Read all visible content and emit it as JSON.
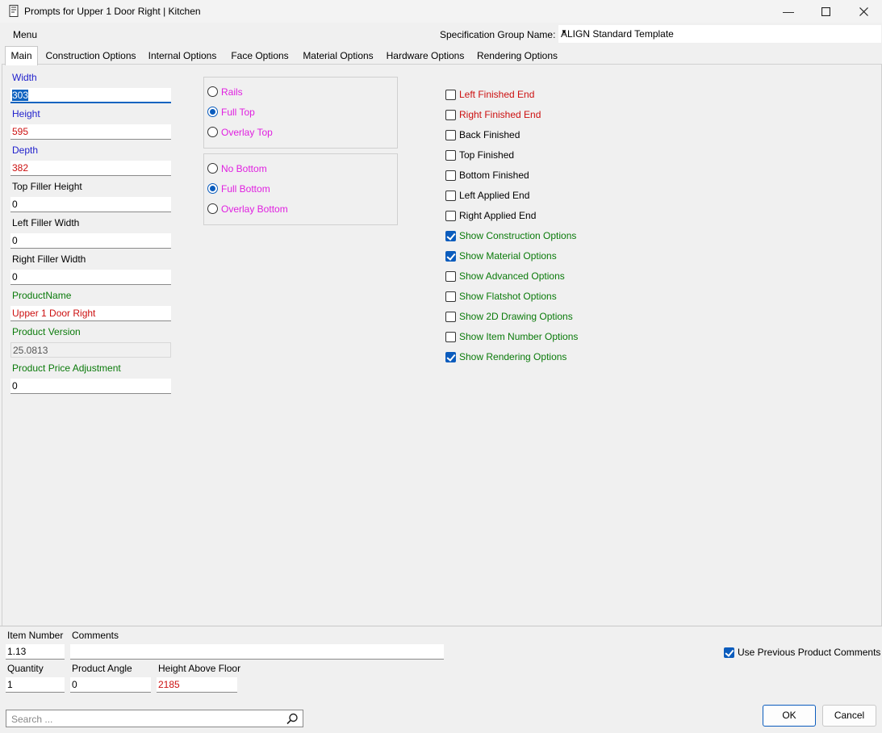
{
  "window": {
    "title": "Prompts for Upper 1 Door Right | Kitchen"
  },
  "menu": {
    "label": "Menu"
  },
  "spec": {
    "label": "Specification Group Name:",
    "value": "ALIGN Standard Template"
  },
  "tabs": [
    "Main",
    "Construction Options",
    "Internal Options",
    "Face Options",
    "Material Options",
    "Hardware Options",
    "Rendering Options"
  ],
  "fields": [
    {
      "label": "Width",
      "value": "303"
    },
    {
      "label": "Height",
      "value": "595"
    },
    {
      "label": "Depth",
      "value": "382"
    },
    {
      "label": "Top Filler Height",
      "value": "0"
    },
    {
      "label": "Left Filler Width",
      "value": "0"
    },
    {
      "label": "Right Filler Width",
      "value": "0"
    },
    {
      "label": "ProductName",
      "value": "Upper 1 Door Right"
    },
    {
      "label": "Product Version",
      "value": "25.0813"
    },
    {
      "label": "Product Price Adjustment",
      "value": "0"
    }
  ],
  "top_group": {
    "options": [
      "Rails",
      "Full Top",
      "Overlay Top"
    ],
    "selected": "Full Top"
  },
  "bottom_group": {
    "options": [
      "No Bottom",
      "Full Bottom",
      "Overlay Bottom"
    ],
    "selected": "Full Bottom"
  },
  "checkboxes": [
    {
      "label": "Left Finished End",
      "checked": false
    },
    {
      "label": "Right Finished End",
      "checked": false
    },
    {
      "label": "Back Finished",
      "checked": false
    },
    {
      "label": "Top Finished",
      "checked": false
    },
    {
      "label": "Bottom Finished",
      "checked": false
    },
    {
      "label": "Left Applied End",
      "checked": false
    },
    {
      "label": "Right Applied End",
      "checked": false
    },
    {
      "label": "Show Construction Options",
      "checked": true
    },
    {
      "label": "Show Material Options",
      "checked": true
    },
    {
      "label": "Show Advanced Options",
      "checked": false
    },
    {
      "label": "Show Flatshot Options",
      "checked": false
    },
    {
      "label": "Show 2D Drawing Options",
      "checked": false
    },
    {
      "label": "Show Item Number Options",
      "checked": false
    },
    {
      "label": "Show Rendering Options",
      "checked": true
    }
  ],
  "bottom": {
    "item_number": {
      "label": "Item Number",
      "value": "1.13"
    },
    "comments": {
      "label": "Comments",
      "value": ""
    },
    "use_previous": {
      "label": "Use Previous Product Comments",
      "checked": true
    },
    "quantity": {
      "label": "Quantity",
      "value": "1"
    },
    "angle": {
      "label": "Product Angle",
      "value": "0"
    },
    "height_floor": {
      "label": "Height Above Floor",
      "value": "2185"
    }
  },
  "search": {
    "placeholder": "Search ..."
  },
  "buttons": {
    "ok": "OK",
    "cancel": "Cancel"
  },
  "colors": {
    "accent": "#0b5cbd",
    "blue_label": "#1e1ecc",
    "red": "#cc1010",
    "green": "#0a7a0a",
    "magenta": "#e020e0"
  }
}
